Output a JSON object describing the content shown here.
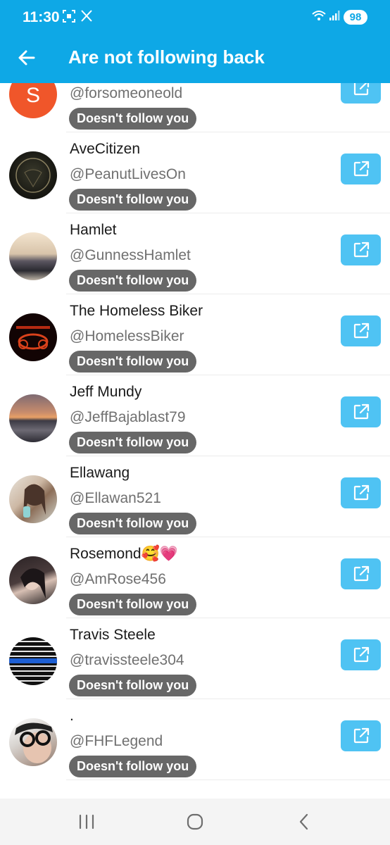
{
  "status_bar": {
    "time": "11:30",
    "battery": "98"
  },
  "app_bar": {
    "title": "Are not following back"
  },
  "colors": {
    "accent": "#0ea8e6",
    "button": "#4fc3f3",
    "badge": "#676767"
  },
  "users": [
    {
      "name": "",
      "handle": "@forsomeoneold",
      "badge": "Doesn't follow you",
      "avatar_letter": "S"
    },
    {
      "name": "AveCitizen",
      "handle": "@PeanutLivesOn",
      "badge": "Doesn't follow you",
      "avatar_letter": ""
    },
    {
      "name": "Hamlet",
      "handle": "@GunnessHamlet",
      "badge": "Doesn't follow you",
      "avatar_letter": ""
    },
    {
      "name": "The Homeless Biker",
      "handle": "@HomelessBiker",
      "badge": "Doesn't follow you",
      "avatar_letter": ""
    },
    {
      "name": "Jeff Mundy",
      "handle": "@JeffBajablast79",
      "badge": "Doesn't follow you",
      "avatar_letter": ""
    },
    {
      "name": "Ellawang",
      "handle": "@Ellawan521",
      "badge": "Doesn't follow you",
      "avatar_letter": ""
    },
    {
      "name": "Rosemond🥰💗",
      "handle": "@AmRose456",
      "badge": "Doesn't follow you",
      "avatar_letter": ""
    },
    {
      "name": "Travis Steele",
      "handle": "@travissteele304",
      "badge": "Doesn't follow you",
      "avatar_letter": ""
    },
    {
      "name": ".",
      "handle": "@FHFLegend",
      "badge": "Doesn't follow you",
      "avatar_letter": ""
    }
  ]
}
